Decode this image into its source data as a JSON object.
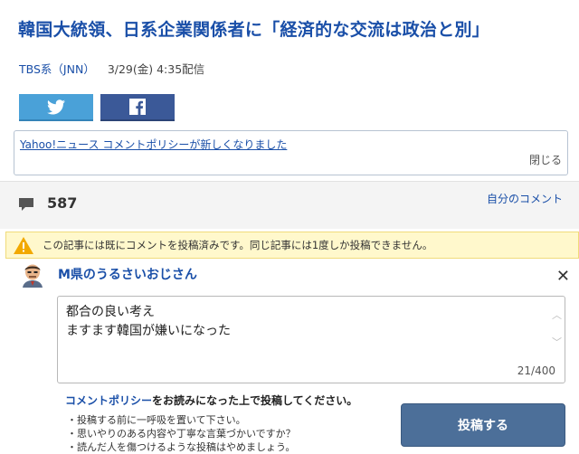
{
  "article": {
    "title": "韓国大統領、日系企業関係者に「経済的な交流は政治と別」",
    "source": "TBS系（JNN）",
    "date": "3/29(金) 4:35配信"
  },
  "notice": {
    "link_text": "Yahoo!ニュース コメントポリシーが新しくなりました",
    "close_label": "閉じる"
  },
  "comments": {
    "count": "587",
    "my_comments_label": "自分のコメント",
    "warning": "この記事には既にコメントを投稿済みです。同じ記事には1度しか投稿できません。"
  },
  "composer": {
    "user_name": "M県のうるさいおじさん",
    "text": "都合の良い考え\nますます韓国が嫌いになった",
    "char_count": "21/400",
    "policy_link": "コメントポリシー",
    "policy_rest": "をお読みになった上で投稿してください。",
    "tips": [
      "・投稿する前に一呼吸を置いて下さい。",
      "・思いやりのある内容や丁寧な言葉づかいですか？",
      "・読んだ人を傷つけるような投稿はやめましょう。"
    ],
    "submit_label": "投稿する"
  },
  "colors": {
    "link": "#1a4fa8",
    "twitter": "#4aa1d8",
    "facebook": "#3b5998",
    "warning_bg": "#fff8cc",
    "submit": "#4c6f99"
  },
  "icons": [
    "twitter-icon",
    "facebook-icon",
    "comment-bubble-icon",
    "warning-icon",
    "close-icon",
    "scroll-up-icon",
    "scroll-down-icon"
  ]
}
